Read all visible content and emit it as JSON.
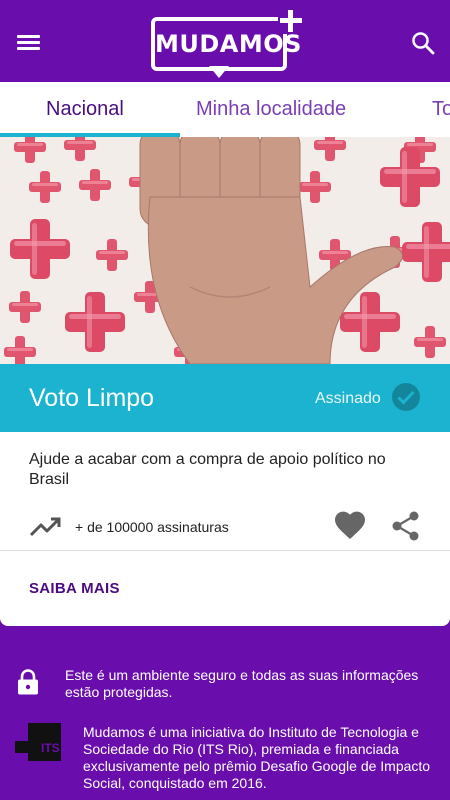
{
  "app": {
    "logo_text": "MUDAMOS"
  },
  "tabs": [
    {
      "label": "Nacional",
      "active": true
    },
    {
      "label": "Minha localidade",
      "active": false
    },
    {
      "label": "To",
      "active": false
    }
  ],
  "petition": {
    "title": "Voto Limpo",
    "status": "Assinado",
    "description": "Ajude a acabar com a compra de apoio político no Brasil",
    "signatures": "+ de 100000 assinaturas",
    "cta": "SAIBA MAIS"
  },
  "footer": {
    "secure_notice": "Este é um ambiente seguro e todas as suas informações estão protegidas.",
    "about": "Mudamos é uma iniciativa do Instituto de Tecnologia e Sociedade do Rio (ITS Rio), premiada e financiada exclusivamente pelo prêmio Desafio Google de Impacto Social, conquistado em 2016.",
    "its_logo_text": "ITS"
  },
  "colors": {
    "primary": "#6a0dad",
    "accent": "#1bb3cf",
    "heart": "#666666",
    "cross": "#e0566f"
  },
  "icons": [
    "menu-icon",
    "search-icon",
    "check-circle-icon",
    "trending-up-icon",
    "heart-icon",
    "share-icon",
    "lock-icon",
    "its-logo"
  ]
}
